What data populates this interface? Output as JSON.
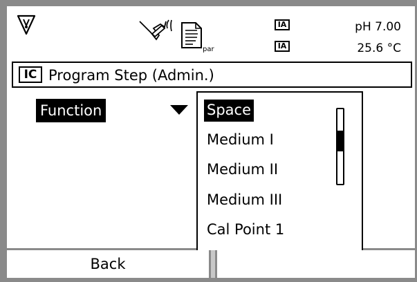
{
  "status": {
    "ia_badge_1": "IA",
    "ia_badge_2": "IA",
    "ph_reading": "pH 7.00",
    "temperature_reading": "25.6 °C",
    "par_label": "par",
    "icons": [
      "wrench-icon",
      "sensor-icon",
      "parameter-document-icon"
    ]
  },
  "title": {
    "badge": "IC",
    "text": "Program Step (Admin.)"
  },
  "field": {
    "label": "Function"
  },
  "list": {
    "items": [
      "Space",
      "Medium I",
      "Medium II",
      "Medium III",
      "Cal Point 1"
    ],
    "selected_index": 0,
    "scroll_position": 0.4
  },
  "softkeys": {
    "left": "Back",
    "right": ""
  }
}
